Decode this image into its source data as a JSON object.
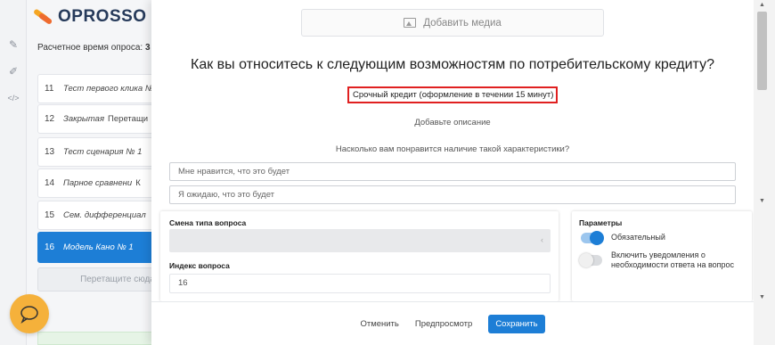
{
  "app": {
    "logo_text": "OPROSSO",
    "estimated_time_label": "Расчетное время опроса:",
    "estimated_time_value": "3"
  },
  "sidebar": {
    "questions": [
      {
        "num": "11",
        "name": "Тест первого клика №",
        "extra": ""
      },
      {
        "num": "12",
        "name": "Закрытая",
        "extra": "Перетащи"
      },
      {
        "num": "13",
        "name": "Тест сценария № 1",
        "extra": ""
      },
      {
        "num": "14",
        "name": "Парное сравнени",
        "extra": "К"
      },
      {
        "num": "15",
        "name": "Сем. дифференциал",
        "extra": ""
      },
      {
        "num": "16",
        "name": "Модель Кано № 1",
        "extra": ""
      }
    ],
    "drag_hint": "Перетащите сюда"
  },
  "editor": {
    "add_media_label": "Добавить медиа",
    "question_title": "Как вы относитесь к следующим возможностям по потребительскому кредиту?",
    "subquestion_value": "Срочный кредит (оформление в течении 15 минут)",
    "add_description": "Добавьте описание",
    "prompt": "Насколько вам понравится наличие такой характеристики?",
    "answers": [
      "Мне нравится, что это будет",
      "Я ожидаю, что это будет"
    ]
  },
  "settings": {
    "change_type_label": "Смена типа вопроса",
    "index_label": "Индекс вопроса",
    "index_value": "16",
    "params_label": "Параметры",
    "required_label": "Обязательный",
    "required_on": true,
    "notify_label": "Включить уведомления о необходимости ответа на вопрос",
    "notify_on": false
  },
  "footer": {
    "cancel": "Отменить",
    "preview": "Предпросмотр",
    "save": "Сохранить"
  },
  "colors": {
    "accent": "#1d7ed6",
    "highlight_border": "#e02020",
    "chat_bubble": "#f5b13b",
    "logo_text": "#263a5a"
  }
}
